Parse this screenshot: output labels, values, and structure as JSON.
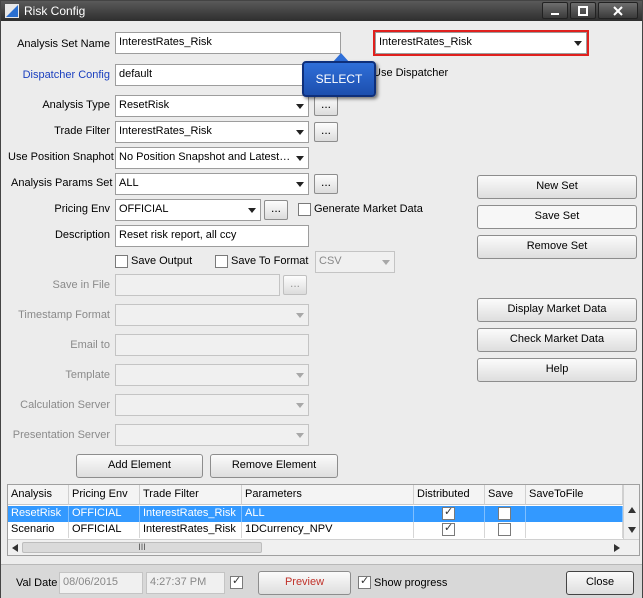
{
  "window": {
    "title": "Risk Config"
  },
  "form": {
    "analysis_set_name": {
      "label": "Analysis Set Name",
      "value": "InterestRates_Risk"
    },
    "analysis_set_select": {
      "value": "InterestRates_Risk"
    },
    "dispatcher_config": {
      "label": "Dispatcher Config",
      "value": "default"
    },
    "use_dispatcher": {
      "label": "Use Dispatcher"
    },
    "analysis_type": {
      "label": "Analysis Type",
      "value": "ResetRisk"
    },
    "trade_filter": {
      "label": "Trade Filter",
      "value": "InterestRates_Risk"
    },
    "use_position_snapshot": {
      "label": "Use Position Snaphot",
      "value": "No Position Snapshot and Latest…"
    },
    "analysis_params_set": {
      "label": "Analysis Params Set",
      "value": "ALL"
    },
    "pricing_env": {
      "label": "Pricing Env",
      "value": "OFFICIAL"
    },
    "generate_market_data": {
      "label": "Generate Market Data",
      "checked": false
    },
    "description": {
      "label": "Description",
      "value": "Reset risk report, all ccy"
    },
    "save_output": {
      "label": "Save Output",
      "checked": false
    },
    "save_to_format": {
      "label": "Save To Format",
      "checked": false,
      "value": "CSV"
    },
    "save_in_file": {
      "label": "Save in File",
      "value": ""
    },
    "timestamp_format": {
      "label": "Timestamp Format",
      "value": ""
    },
    "email_to": {
      "label": "Email to",
      "value": ""
    },
    "template": {
      "label": "Template",
      "value": ""
    },
    "calculation_server": {
      "label": "Calculation Server",
      "value": ""
    },
    "presentation_server": {
      "label": "Presentation Server",
      "value": ""
    },
    "dots_label": "...",
    "dots_label_small": "..."
  },
  "tooltip": {
    "text": "SELECT"
  },
  "right_buttons": {
    "new_set": "New Set",
    "save_set": "Save Set",
    "remove_set": "Remove Set",
    "display_market_data": "Display Market Data",
    "check_market_data": "Check Market Data",
    "help": "Help"
  },
  "element_buttons": {
    "add": "Add Element",
    "remove": "Remove Element"
  },
  "table": {
    "columns": [
      "Analysis",
      "Pricing Env",
      "Trade Filter",
      "Parameters",
      "Distributed",
      "Save",
      "SaveToFile"
    ],
    "rows": [
      {
        "analysis": "ResetRisk",
        "pricing_env": "OFFICIAL",
        "trade_filter": "InterestRates_Risk",
        "parameters": "ALL",
        "distributed": true,
        "save": false,
        "selected": true
      },
      {
        "analysis": "Scenario",
        "pricing_env": "OFFICIAL",
        "trade_filter": "InterestRates_Risk",
        "parameters": "1DCurrency_NPV",
        "distributed": true,
        "save": false,
        "selected": false
      }
    ],
    "scroll_grip": "III"
  },
  "bottom": {
    "val_date_label": "Val Date",
    "val_date": "08/06/2015",
    "val_time": "4:27:37 PM",
    "time_checked": true,
    "preview": "Preview",
    "show_progress_label": "Show progress",
    "show_progress_checked": true,
    "close": "Close"
  },
  "colors": {
    "highlight_border": "#e0201e",
    "tooltip_bg": "#2f6fd8",
    "selected_row": "#3399ff",
    "link_label": "#1a3fbf"
  }
}
